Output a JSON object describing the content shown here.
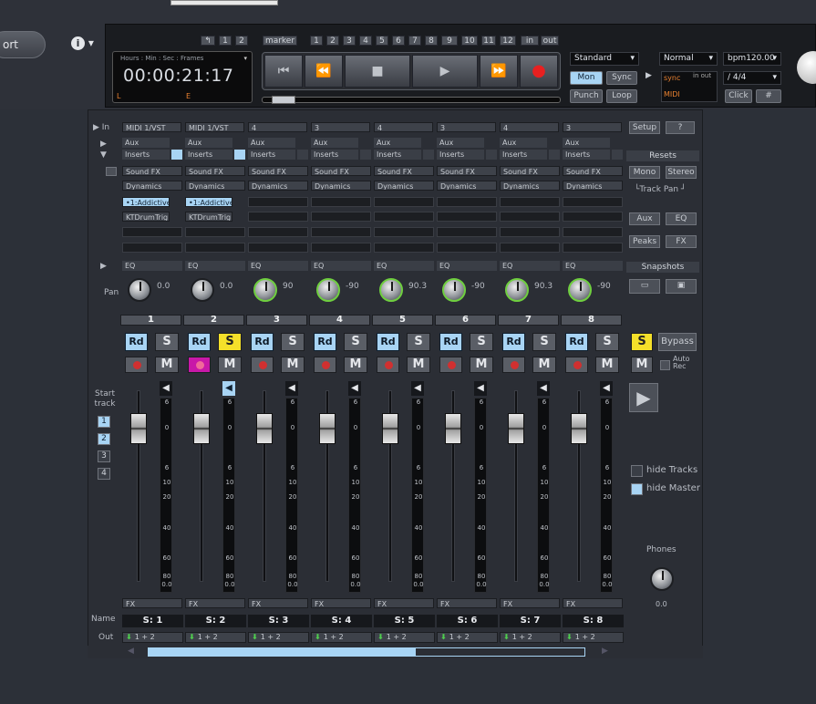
{
  "app": {
    "export_label": "ort",
    "info_label": "ℹ ▾"
  },
  "markers": {
    "back": "↰",
    "m1": "1",
    "m2": "2",
    "marker_label": "marker",
    "nums": [
      "1",
      "2",
      "3",
      "4",
      "5",
      "6",
      "7",
      "8",
      "9",
      "10",
      "11",
      "12"
    ],
    "in": "in",
    "out": "out"
  },
  "timecode": {
    "header": "Hours : Min : Sec : Frames",
    "value": "00:00:21:17",
    "left": "L",
    "end": "E"
  },
  "transport": {
    "rewind_start": "⏮",
    "rewind": "⏪",
    "stop": "■",
    "play": "▶",
    "forward": "⏩",
    "record": "●"
  },
  "modes": {
    "standard": "Standard",
    "mon": "Mon",
    "sync": "Sync",
    "punch": "Punch",
    "loop": "Loop"
  },
  "sync_panel": {
    "normal": "Normal",
    "bpm": "bpm120.00",
    "sync": "sync",
    "in_out": "in out",
    "midi": "MIDI",
    "sig": "/ 4/4",
    "click": "Click"
  },
  "mixer": {
    "input_label": "▶ In",
    "aux_label": "Aux",
    "inserts_label": "Inserts",
    "eq_label": "EQ",
    "pan_label": "Pan",
    "start_track_label": "Start track",
    "name_label": "Name",
    "out_label": "Out",
    "setup": "Setup",
    "help": "?",
    "resets": "Resets",
    "mono": "Mono",
    "stereo": "Stereo",
    "track_pan": "└Track Pan ┘",
    "aux_btn": "Aux",
    "eq_btn": "EQ",
    "peaks": "Peaks",
    "fx_btn": "FX",
    "snapshots": "Snapshots",
    "bypass": "Bypass",
    "auto_rec": "Auto Rec",
    "hide_tracks": "hide Tracks",
    "hide_master": "hide Master",
    "phones": "Phones",
    "phones_val": "0.0",
    "s_master": "S",
    "m_master": "M",
    "play": "▶",
    "start_tracks": [
      "1",
      "2",
      "3",
      "4"
    ],
    "meter_labels": [
      "6",
      "0",
      "6",
      "10",
      "20",
      "40",
      "60",
      "80",
      "0.0"
    ],
    "channels": [
      {
        "input": "MIDI 1/VST",
        "num": "1",
        "pan": "0.0",
        "name": "S: 1",
        "out": "1 + 2",
        "fx1": "•1:Addictive",
        "fx2": "KTDrumTrig"
      },
      {
        "input": "MIDI 1/VST",
        "num": "2",
        "pan": "0.0",
        "name": "S: 2",
        "out": "1 + 2",
        "fx1": "•1:Addictive",
        "fx2": "KTDrumTrig"
      },
      {
        "input": "4",
        "num": "3",
        "pan": "90",
        "name": "S: 3",
        "out": "1 + 2"
      },
      {
        "input": "3",
        "num": "4",
        "pan": "-90",
        "name": "S: 4",
        "out": "1 + 2"
      },
      {
        "input": "4",
        "num": "5",
        "pan": "90.3",
        "name": "S: 5",
        "out": "1 + 2"
      },
      {
        "input": "3",
        "num": "6",
        "pan": "-90",
        "name": "S: 6",
        "out": "1 + 2"
      },
      {
        "input": "4",
        "num": "7",
        "pan": "90.3",
        "name": "S: 7",
        "out": "1 + 2"
      },
      {
        "input": "3",
        "num": "8",
        "pan": "-90",
        "name": "S: 8",
        "out": "1 + 2"
      }
    ],
    "sound_fx": "Sound FX",
    "dynamics": "Dynamics",
    "fx_select": "FX",
    "rd": "Rd",
    "s": "S",
    "m": "M"
  }
}
